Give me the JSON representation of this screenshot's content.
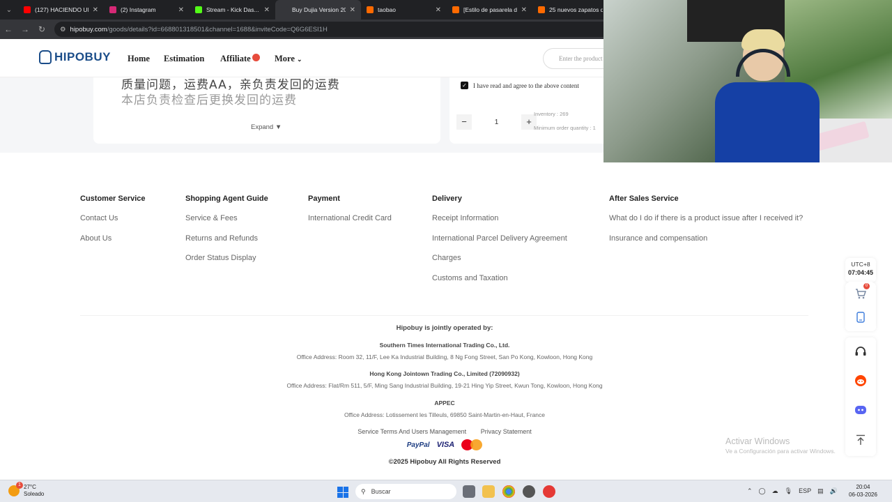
{
  "browser": {
    "tabs": [
      {
        "title": "(127) HACIENDO UN...",
        "color": "#ff0000",
        "active": false
      },
      {
        "title": "(2) Instagram",
        "color": "#d62976",
        "active": false
      },
      {
        "title": "Stream - Kick Das...",
        "color": "#53fc18",
        "active": false
      },
      {
        "title": "Buy Dujia Version 202...",
        "color": "#35363a",
        "active": true
      },
      {
        "title": "taobao",
        "color": "#ff6a00",
        "active": false
      },
      {
        "title": "[Estilo de pasarela de...",
        "color": "#ff6a00",
        "active": false
      },
      {
        "title": "25 nuevos zapatos d...",
        "color": "#ff6a00",
        "active": false
      }
    ],
    "url_host": "hipobuy.com",
    "url_path": "/goods/details?id=668801318501&channel=1688&inviteCode=Q6G6ESI1H"
  },
  "header": {
    "logo": "HIPOBUY",
    "nav": [
      "Home",
      "Estimation",
      "Affiliate",
      "More"
    ],
    "affiliate_badge": "🔥",
    "search_placeholder": "Enter the product"
  },
  "product": {
    "desc_line1": "质量问题，运费AA，亲负责发回的运费",
    "desc_line2": "本店负责检查后更换发回的运费",
    "expand_label": "Expand ▼",
    "agree_text": "I have read and agree to the above content",
    "quantity": "1",
    "inventory": "Inventory : 269",
    "min_order": "Minimum order quantity : 1"
  },
  "footer": {
    "columns": [
      {
        "title": "Customer Service",
        "links": [
          "Contact Us",
          "About Us"
        ]
      },
      {
        "title": "Shopping Agent Guide",
        "links": [
          "Service & Fees",
          "Returns and Refunds",
          "Order Status Display"
        ]
      },
      {
        "title": "Payment",
        "links": [
          "International Credit Card"
        ]
      },
      {
        "title": "Delivery",
        "links": [
          "Receipt Information",
          "International Parcel Delivery Agreement",
          "Charges",
          "Customs and Taxation"
        ]
      },
      {
        "title": "After Sales Service",
        "links": [
          "What do I do if there is a product issue after I received it?",
          "Insurance and compensation"
        ]
      }
    ],
    "operated_by": "Hipobuy is jointly operated by:",
    "companies": [
      {
        "name": "Southern Times International Trading Co., Ltd.",
        "address": "Office Address: Room 32, 11/F, Lee Ka Industrial Building, 8 Ng Fong Street, San Po Kong, Kowloon, Hong Kong"
      },
      {
        "name": "Hong Kong Jointown Trading Co., Limited (72090932)",
        "address": "Office Address: Flat/Rm 511, 5/F, Ming Sang Industrial Building, 19-21 Hing Yip Street, Kwun Tong, Kowloon, Hong Kong"
      },
      {
        "name": "APPEC",
        "address": "Office Address: Lotissement les Tilleuls, 69850 Saint-Martin-en-Haut, France"
      }
    ],
    "terms": "Service Terms And Users Management",
    "privacy": "Privacy Statement",
    "payments": {
      "paypal": "PayPal",
      "visa": "VISA"
    },
    "copyright": "©2025 Hipobuy All Rights Reserved"
  },
  "sidebar": {
    "timezone": "UTC+8",
    "time": "07:04:45",
    "cart_count": "0"
  },
  "windows": {
    "activate_title": "Activar Windows",
    "activate_sub": "Ve a Configuración para activar Windows."
  },
  "taskbar": {
    "temp": "27°C",
    "weather": "Soleado",
    "search": "Buscar",
    "lang": "ESP",
    "time": "20:04",
    "date": "06-03-2026",
    "notif": "1"
  }
}
